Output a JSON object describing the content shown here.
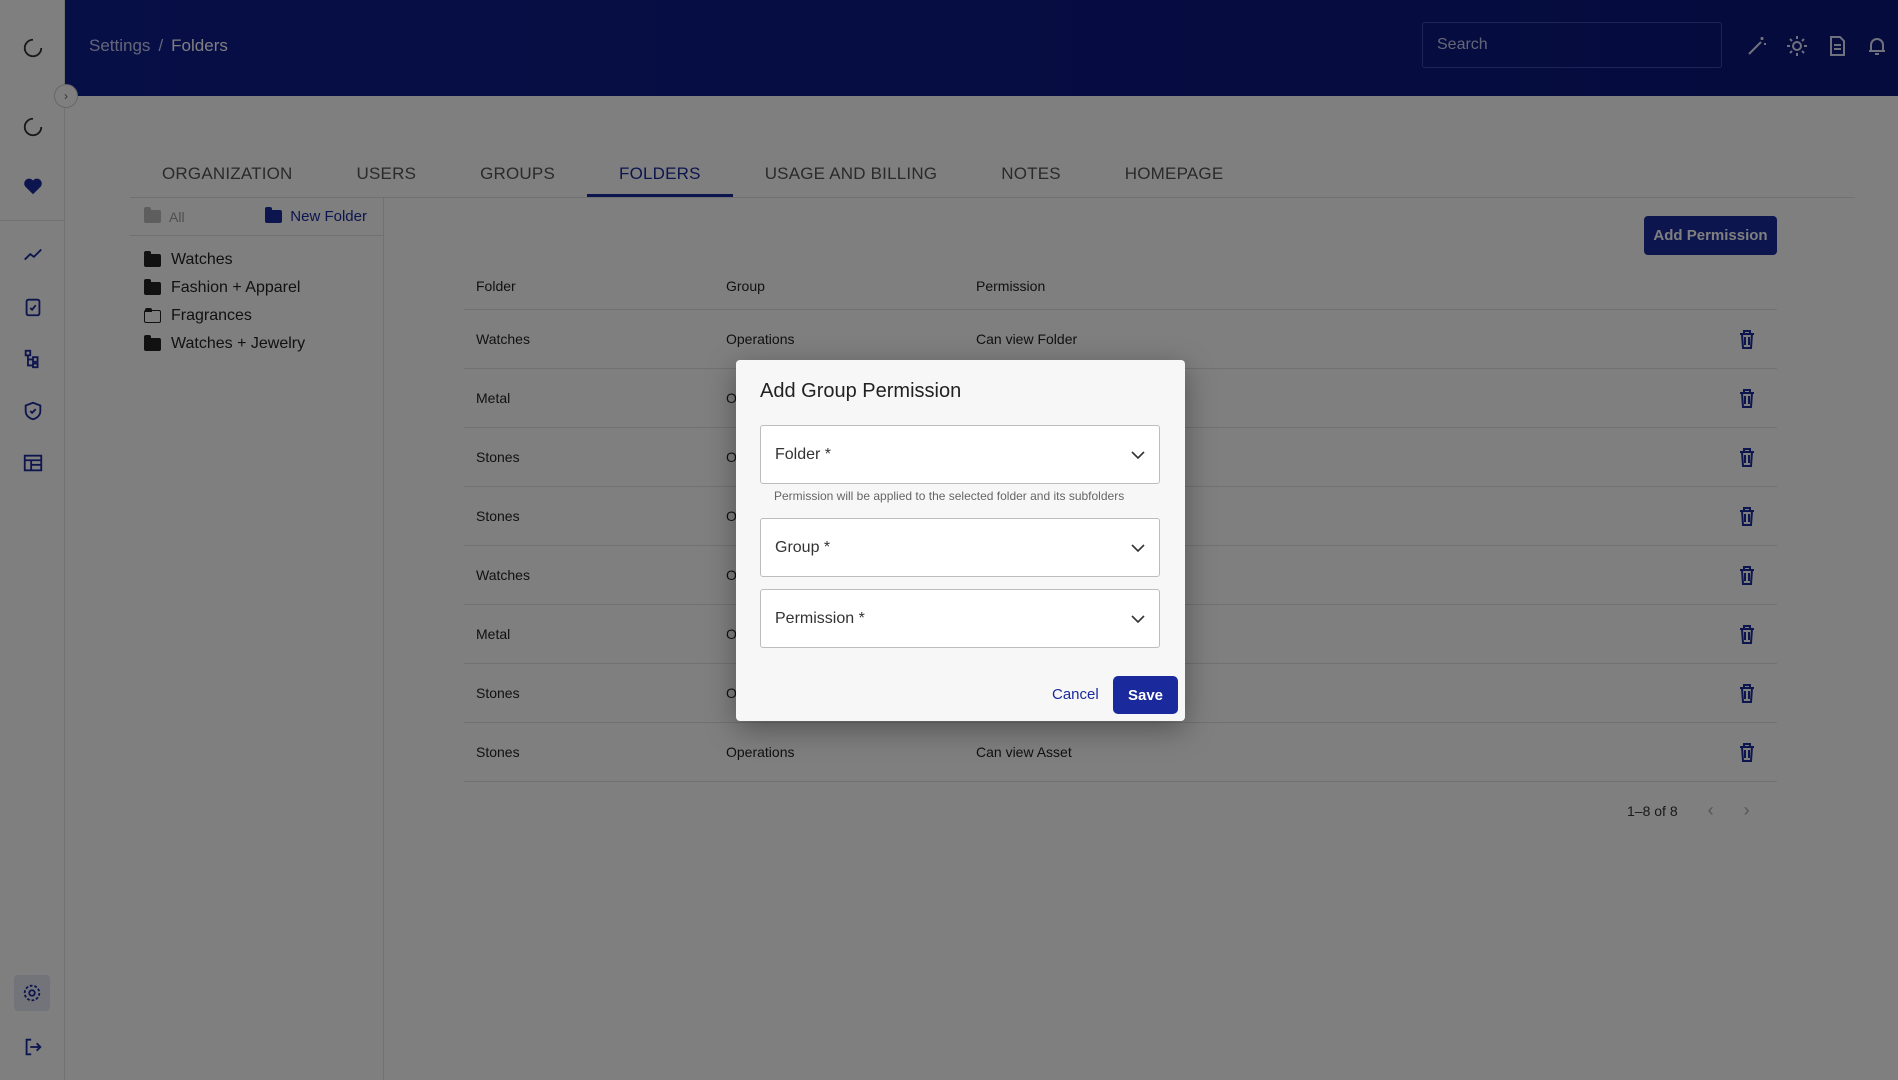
{
  "header": {
    "breadcrumb_root": "Settings",
    "breadcrumb_sep": "/",
    "breadcrumb_current": "Folders",
    "search_placeholder": "Search"
  },
  "tabs": [
    {
      "label": "ORGANIZATION"
    },
    {
      "label": "USERS"
    },
    {
      "label": "GROUPS"
    },
    {
      "label": "FOLDERS",
      "active": true
    },
    {
      "label": "USAGE AND BILLING"
    },
    {
      "label": "NOTES"
    },
    {
      "label": "HOMEPAGE"
    }
  ],
  "folder_pane": {
    "all_label": "All",
    "new_folder_label": "New Folder",
    "folders": [
      {
        "name": "Watches"
      },
      {
        "name": "Fashion + Apparel"
      },
      {
        "name": "Fragrances"
      },
      {
        "name": "Watches + Jewelry"
      }
    ]
  },
  "permissions": {
    "add_button": "Add Permission",
    "columns": [
      "Folder",
      "Group",
      "Permission"
    ],
    "rows": [
      {
        "folder": "Watches",
        "group": "Operations",
        "permission": "Can view Folder"
      },
      {
        "folder": "Metal",
        "group": "O",
        "permission": ""
      },
      {
        "folder": "Stones",
        "group": "O",
        "permission": ""
      },
      {
        "folder": "Stones",
        "group": "O",
        "permission": ""
      },
      {
        "folder": "Watches",
        "group": "O",
        "permission": ""
      },
      {
        "folder": "Metal",
        "group": "O",
        "permission": ""
      },
      {
        "folder": "Stones",
        "group": "O",
        "permission": ""
      },
      {
        "folder": "Stones",
        "group": "Operations",
        "permission": "Can view Asset"
      }
    ],
    "pagination": "1–8 of 8"
  },
  "dialog": {
    "title": "Add Group Permission",
    "folder_label": "Folder *",
    "folder_helper": "Permission will be applied to the selected folder and its subfolders",
    "group_label": "Group *",
    "permission_label": "Permission *",
    "cancel_label": "Cancel",
    "save_label": "Save"
  },
  "colors": {
    "primary": "#1a2a9c",
    "header_bg": "#0f1e8f"
  }
}
